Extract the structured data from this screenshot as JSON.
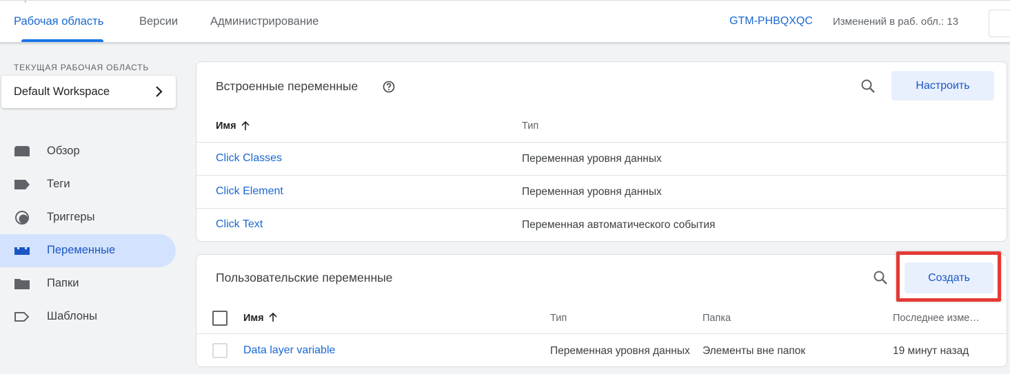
{
  "header": {
    "tabs": [
      {
        "label": "Рабочая область",
        "active": true
      },
      {
        "label": "Версии",
        "active": false
      },
      {
        "label": "Администрирование",
        "active": false
      }
    ],
    "container_id": "GTM-PHBQXQC",
    "changes": "Изменений в раб. обл.: 13"
  },
  "sidebar": {
    "workspace_label": "ТЕКУЩАЯ РАБОЧАЯ ОБЛАСТЬ",
    "workspace_name": "Default Workspace",
    "items": [
      {
        "label": "Обзор",
        "icon": "overview-icon"
      },
      {
        "label": "Теги",
        "icon": "tag-icon"
      },
      {
        "label": "Триггеры",
        "icon": "trigger-icon"
      },
      {
        "label": "Переменные",
        "icon": "variables-icon",
        "active": true
      },
      {
        "label": "Папки",
        "icon": "folder-icon"
      },
      {
        "label": "Шаблоны",
        "icon": "template-icon"
      }
    ]
  },
  "builtin": {
    "title": "Встроенные переменные",
    "configure_label": "Настроить",
    "col_name": "Имя",
    "col_type": "Тип",
    "rows": [
      {
        "name": "Click Classes",
        "type": "Переменная уровня данных"
      },
      {
        "name": "Click Element",
        "type": "Переменная уровня данных"
      },
      {
        "name": "Click Text",
        "type": "Переменная автоматического события"
      }
    ]
  },
  "custom": {
    "title": "Пользовательские переменные",
    "create_label": "Создать",
    "col_name": "Имя",
    "col_type": "Тип",
    "col_folder": "Папка",
    "col_modified": "Последнее изме…",
    "rows": [
      {
        "name": "Data layer variable",
        "type": "Переменная уровня данных",
        "folder": "Элементы вне папок",
        "modified": "19 минут назад"
      }
    ]
  },
  "colors": {
    "accent": "#1a73e8",
    "link": "#1967d2",
    "highlight": "#e53935",
    "active_nav_bg": "#d3e3fd"
  }
}
